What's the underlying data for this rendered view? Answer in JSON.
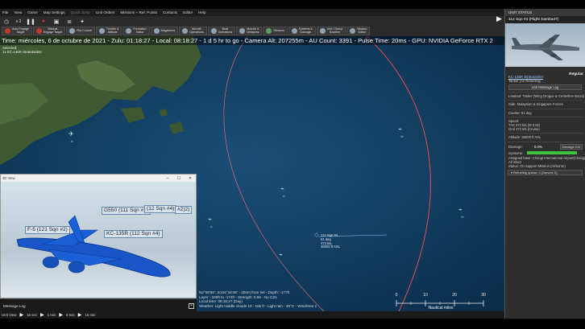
{
  "menu": [
    "File",
    "View",
    "Game",
    "Map Settings",
    "Quick Jump",
    "Unit Orders",
    "Missions + Ref. Points",
    "Contacts",
    "Editor",
    "Help"
  ],
  "menu_disabled": [
    "Quick Jump"
  ],
  "toolbar": {
    "clock_label": "x 2",
    "buttons": [
      {
        "label": "Auto Engage\nTarget",
        "icon": "target-icon",
        "color": "red"
      },
      {
        "label": "Manual\nEngage Target",
        "icon": "crosshair-icon",
        "color": "red"
      },
      {
        "label": "Plot Course",
        "icon": "course-icon",
        "color": "blue"
      },
      {
        "label": "Throttle &\nAltitude",
        "icon": "throttle-icon",
        "color": "blue"
      },
      {
        "label": "Formation\nEditor",
        "icon": "formation-icon",
        "color": "blue"
      },
      {
        "label": "Magazines",
        "icon": "magazine-icon",
        "color": "blue"
      },
      {
        "label": "Aircraft\nOperations",
        "icon": "aircraft-icon",
        "color": "blue"
      },
      {
        "label": "Boat\nOperations",
        "icon": "boat-icon",
        "color": "blue"
      },
      {
        "label": "Mounts &\nWeapons",
        "icon": "weapons-icon",
        "color": "blue"
      },
      {
        "label": "Sensors",
        "icon": "sensor-icon",
        "color": "green"
      },
      {
        "label": "Systems &\nDamage",
        "icon": "gear-icon",
        "color": "blue"
      },
      {
        "label": "Unit / Group\nDoctrine",
        "icon": "doctrine-icon",
        "color": "blue"
      },
      {
        "label": "Mission\nEditor",
        "icon": "mission-icon",
        "color": "blue"
      }
    ]
  },
  "status_line": "Time: miércoles, 6 de octubre de 2021 - Zulu: 01:18:27 - Local: 08:18:27 - 1 d 5 hr to go -   Camera Alt: 207255m - AU Count: 3391 - Pulse Time: 20ms - GPU: NVIDIA GeForce RTX 2",
  "selected": {
    "title": "Selected:",
    "unit": "1x KC-135R Stratotanker"
  },
  "map_units": [
    {
      "name": "112 Sqn #4",
      "lines": [
        "91 deg",
        "473 kts",
        "36000 ft ASL"
      ]
    }
  ],
  "unit_subs": [
    "A",
    "A",
    "A",
    "W",
    "W"
  ],
  "cursor_info": [
    "N2°06'55\", E104°34'45\" - 20nm from sel - Depth: -177ft",
    "Layer: -109ft to -174ft - Strength: 0.66 - No CZs",
    "Local time: 08:18:27 (Day)",
    "Weather: Light middle clouds 10 - 16k ft - Light rain - 45°C - Wind/Sea 2"
  ],
  "scale": {
    "ticks": [
      "0",
      "10",
      "20",
      "30"
    ],
    "unit": "Nautical miles"
  },
  "view3d": {
    "title": "3D View",
    "labels": [
      "G550 (111 Sqn #1)",
      "F-5 (121 Sqn #2)",
      "KC-135R (112 Sqn #4)",
      "(12 Sqn #4)",
      "#2)2)"
    ]
  },
  "message_log": "Message Log",
  "timebar": [
    "Unit View",
    "15 sec",
    "1 min",
    "5 min",
    "15 min"
  ],
  "side": {
    "header": "UNIT STATUS",
    "unit_name": "112 Sqn #4 (Flight Samba47)",
    "condition": "Regular",
    "type_link": "KC-135R Stratotanker",
    "role": "Tanker (Air Refueling)",
    "message_log_btn": "Unit Message Log",
    "loadout": "Loadout: Tanker [Wing Drogue & Centerline Boom]",
    "side": "Side: Malaysian & Singapore Forces",
    "course": "Course: 91 deg",
    "speed_title": "Speed:",
    "tas": "TAS 472 kts (M 0.82)",
    "gnd": "Gnd 472 kts (Cruise)",
    "altitude": "Altitude: 36000 ft ASL",
    "damage_label": "Damage:",
    "damage_value": "0.0%",
    "damage_btn": "Damage Ctrl",
    "systems_label": "Systems:",
    "systems_level": 1.0,
    "assigned": "Assigned base: Changi International Airport(Changi",
    "all_intact": "All intact",
    "status": "Status: On Support Mission (Airborne)",
    "refuel_queue": "Refueling queue: 0 (Served: 0)"
  }
}
